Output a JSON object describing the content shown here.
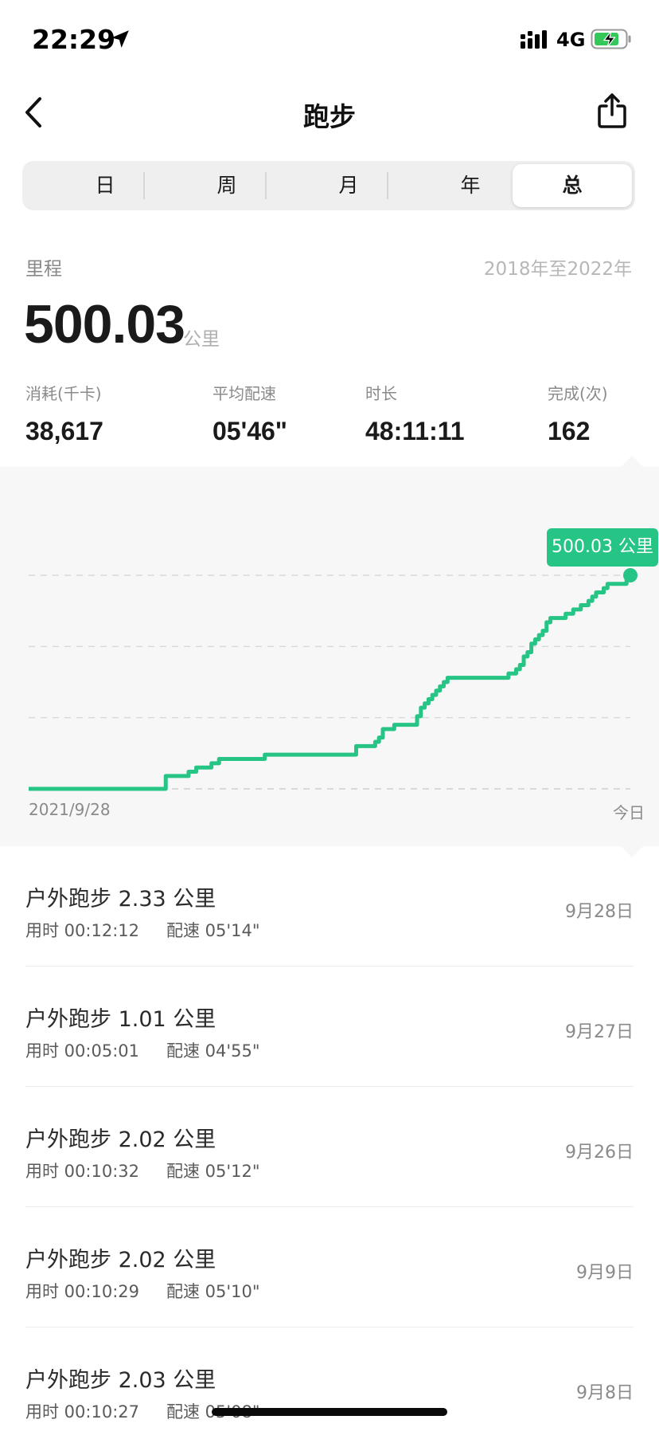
{
  "status_bar": {
    "time": "22:29",
    "network": "4G",
    "icons": [
      "location-arrow-icon",
      "signal-icon",
      "battery-charging-icon"
    ]
  },
  "nav": {
    "title": "跑步",
    "icons": [
      "back-chevron-icon",
      "share-icon"
    ]
  },
  "segments": {
    "items": [
      "日",
      "周",
      "月",
      "年",
      "总"
    ],
    "selected": "总"
  },
  "summary": {
    "distance_label": "里程",
    "date_range": "2018年至2022年",
    "total_distance": "500.03",
    "unit": "公里",
    "stats": [
      {
        "label": "消耗(千卡)",
        "value": "38,617"
      },
      {
        "label": "平均配速",
        "value": "05'46\""
      },
      {
        "label": "时长",
        "value": "48:11:11"
      },
      {
        "label": "完成(次)",
        "value": "162"
      }
    ]
  },
  "chart_data": {
    "type": "line",
    "x_start_label": "2021/9/28",
    "x_end_label": "今日",
    "tooltip": "500.03 公里",
    "line_color": "#26c586",
    "grid": true,
    "series": [
      {
        "values": [
          0,
          0,
          0,
          0,
          0,
          0,
          0,
          0,
          0,
          0,
          0,
          0,
          0,
          0,
          0,
          0,
          0,
          0,
          0,
          0,
          0,
          0,
          0,
          0,
          0,
          0,
          0,
          0,
          0,
          0,
          0,
          0,
          0,
          0,
          0,
          0,
          6,
          6,
          6,
          6,
          6,
          6,
          8,
          8,
          10,
          10,
          10,
          10,
          12,
          12,
          14,
          14,
          14,
          14,
          14,
          14,
          14,
          14,
          14,
          14,
          14,
          14,
          16,
          16,
          16,
          16,
          16,
          16,
          16,
          16,
          16,
          16,
          16,
          16,
          16,
          16,
          16,
          16,
          16,
          16,
          16,
          16,
          16,
          16,
          16,
          16,
          20,
          20,
          20,
          20,
          20,
          22,
          24,
          28,
          28,
          28,
          30,
          30,
          30,
          30,
          30,
          30,
          34,
          38,
          40,
          42,
          44,
          46,
          48,
          50,
          52,
          52,
          52,
          52,
          52,
          52,
          52,
          52,
          52,
          52,
          52,
          52,
          52,
          52,
          52,
          52,
          54,
          54,
          56,
          58,
          62,
          64,
          68,
          70,
          72,
          74,
          78,
          80,
          80,
          80,
          80,
          82,
          82,
          84,
          84,
          86,
          86,
          88,
          90,
          92,
          92,
          94,
          96,
          96,
          96,
          96,
          96,
          98,
          100
        ],
        "y_max": 100
      }
    ]
  },
  "runs": [
    {
      "title": "户外跑步 2.33 公里",
      "duration": "用时 00:12:12",
      "pace": "配速 05'14\"",
      "date": "9月28日"
    },
    {
      "title": "户外跑步 1.01 公里",
      "duration": "用时 00:05:01",
      "pace": "配速 04'55\"",
      "date": "9月27日"
    },
    {
      "title": "户外跑步 2.02 公里",
      "duration": "用时 00:10:32",
      "pace": "配速 05'12\"",
      "date": "9月26日"
    },
    {
      "title": "户外跑步 2.02 公里",
      "duration": "用时 00:10:29",
      "pace": "配速 05'10\"",
      "date": "9月9日"
    },
    {
      "title": "户外跑步 2.03 公里",
      "duration": "用时 00:10:27",
      "pace": "配速 05'08\"",
      "date": "9月8日"
    }
  ]
}
